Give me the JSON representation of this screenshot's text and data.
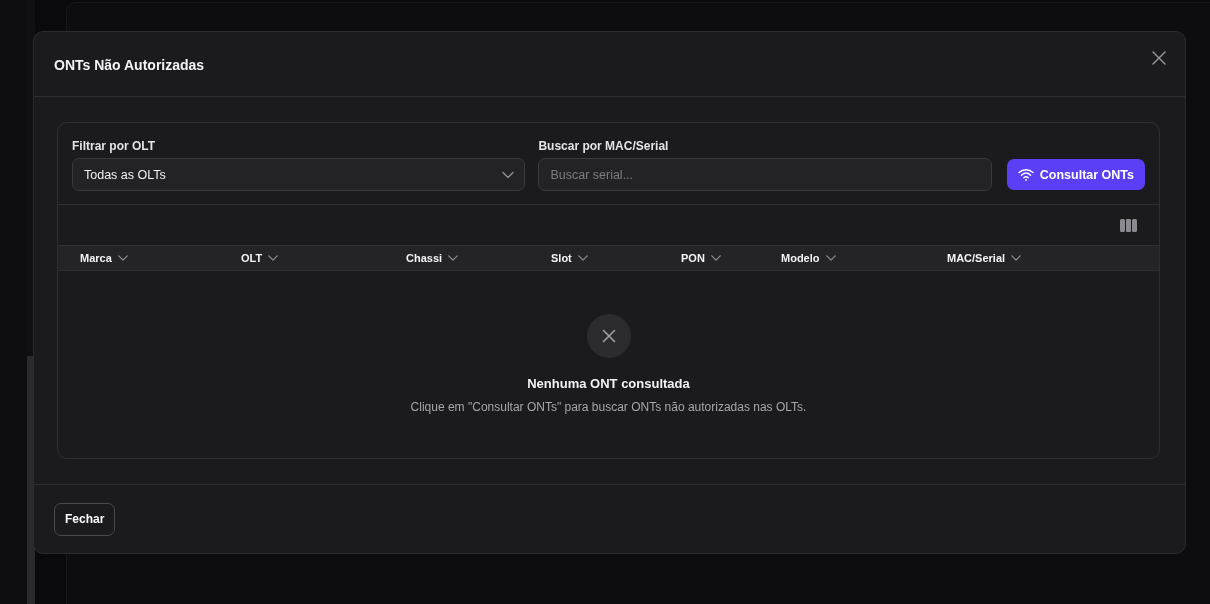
{
  "dialog": {
    "title": "ONTs Não Autorizadas"
  },
  "filters": [
    {
      "kind": "select",
      "label": "Filtrar por OLT",
      "value": "Todas as OLTs"
    },
    {
      "kind": "text",
      "label": "Buscar por MAC/Serial",
      "placeholder": "Buscar serial..."
    }
  ],
  "query_button": {
    "label": "Consultar ONTs"
  },
  "table": {
    "columns": [
      "Marca",
      "OLT",
      "Chassi",
      "Slot",
      "PON",
      "Modelo",
      "MAC/Serial"
    ],
    "empty_state": {
      "title": "Nenhuma ONT consultada",
      "message": "Clique em \"Consultar ONTs\" para buscar ONTs não autorizadas nas OLTs."
    }
  },
  "footer": {
    "buttons": [
      "Fechar"
    ]
  }
}
